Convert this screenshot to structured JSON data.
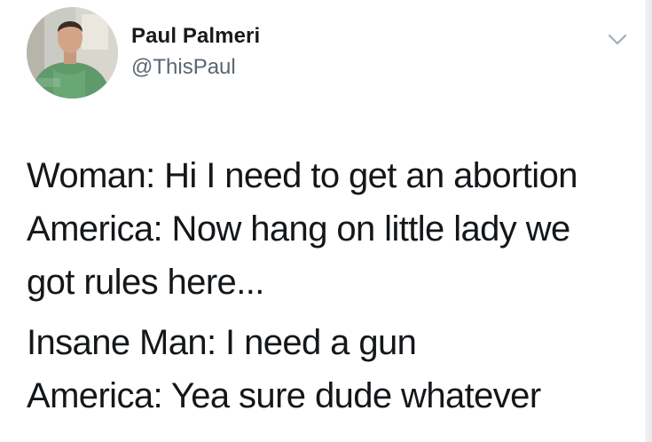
{
  "author": {
    "display_name": "Paul Palmeri",
    "handle": "@ThisPaul",
    "avatar_icon": "user-avatar-photo"
  },
  "menu": {
    "icon": "chevron-down-icon"
  },
  "tweet": {
    "paragraphs": [
      "Woman: Hi I need to get an abortion\nAmerica: Now hang on little lady we\ngot rules here...",
      "Insane Man: I need a gun\nAmerica: Yea sure dude whatever"
    ]
  },
  "colors": {
    "text": "#14171a",
    "muted": "#5b6670",
    "chevron": "#a3adb6",
    "background": "#ffffff"
  }
}
